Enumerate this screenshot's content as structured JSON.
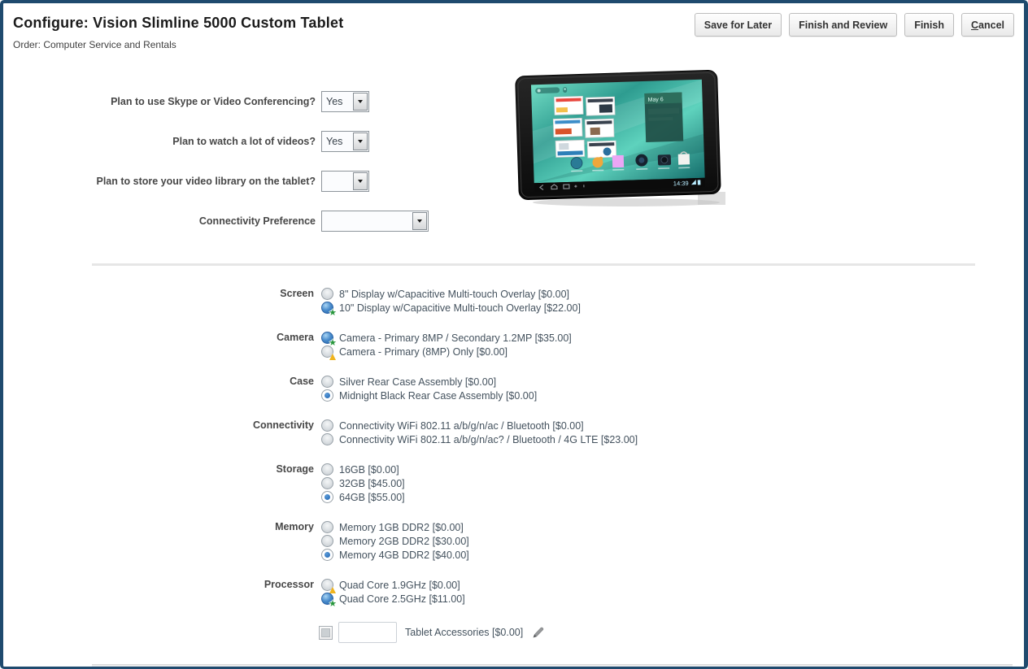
{
  "page": {
    "title": "Configure: Vision Slimline 5000 Custom Tablet",
    "subtitle": "Order: Computer Service and Rentals"
  },
  "toolbar": {
    "buttons": [
      {
        "label": "Save for Later",
        "underline_first_letter": false
      },
      {
        "label": "Finish and Review",
        "underline_first_letter": false
      },
      {
        "label": "Finish",
        "underline_first_letter": false
      },
      {
        "label": "Cancel",
        "underline_first_letter": true
      }
    ]
  },
  "questions": [
    {
      "label": "Plan to use Skype or Video Conferencing?",
      "value": "Yes",
      "size": "small"
    },
    {
      "label": "Plan to watch a lot of videos?",
      "value": "Yes",
      "size": "small"
    },
    {
      "label": "Plan to store your video library on the tablet?",
      "value": "",
      "size": "small"
    },
    {
      "label": "Connectivity Preference",
      "value": "",
      "size": "large"
    }
  ],
  "product_image": {
    "description": "black tablet with teal home screen",
    "time": "14:39",
    "widget_date": "May 6"
  },
  "option_groups": [
    {
      "label": "Screen",
      "options": [
        {
          "text": "8\" Display w/Capacitive Multi-touch Overlay [$0.00]",
          "state": "unselected"
        },
        {
          "text": "10\" Display w/Capacitive Multi-touch Overlay [$22.00]",
          "state": "selected-recommended"
        }
      ]
    },
    {
      "label": "Camera",
      "options": [
        {
          "text": "Camera - Primary 8MP / Secondary 1.2MP [$35.00]",
          "state": "selected-recommended"
        },
        {
          "text": "Camera - Primary (8MP) Only [$0.00]",
          "state": "unselected-warning"
        }
      ]
    },
    {
      "label": "Case",
      "options": [
        {
          "text": "Silver Rear Case Assembly [$0.00]",
          "state": "unselected"
        },
        {
          "text": "Midnight Black Rear Case Assembly [$0.00]",
          "state": "selected"
        }
      ]
    },
    {
      "label": "Connectivity",
      "options": [
        {
          "text": "Connectivity WiFi 802.11 a/b/g/n/ac / Bluetooth [$0.00]",
          "state": "unselected"
        },
        {
          "text": "Connectivity WiFi 802.11 a/b/g/n/ac? / Bluetooth / 4G LTE [$23.00]",
          "state": "unselected"
        }
      ]
    },
    {
      "label": "Storage",
      "options": [
        {
          "text": "16GB [$0.00]",
          "state": "unselected"
        },
        {
          "text": "32GB [$45.00]",
          "state": "unselected"
        },
        {
          "text": "64GB [$55.00]",
          "state": "selected"
        }
      ]
    },
    {
      "label": "Memory",
      "options": [
        {
          "text": "Memory 1GB DDR2 [$0.00]",
          "state": "unselected"
        },
        {
          "text": "Memory 2GB DDR2 [$30.00]",
          "state": "unselected"
        },
        {
          "text": "Memory 4GB DDR2 [$40.00]",
          "state": "selected"
        }
      ]
    },
    {
      "label": "Processor",
      "options": [
        {
          "text": "Quad Core 1.9GHz [$0.00]",
          "state": "unselected-warning"
        },
        {
          "text": "Quad Core 2.5GHz [$11.00]",
          "state": "selected-recommended"
        }
      ]
    }
  ],
  "accessories": {
    "checked": false,
    "quantity_value": "",
    "label": "Tablet Accessories [$0.00]"
  },
  "icons": {
    "recommended_star": "★",
    "warning_triangle": "▲",
    "dropdown_arrow": "▼",
    "edit": "pencil"
  },
  "colors": {
    "frame_navy": "#1f4a6e",
    "recommended_green": "#27963c",
    "warning_amber": "#f0b41e",
    "selected_blue": "#2a6fc0",
    "screen_teal": "#2e9c90",
    "divider_gray": "#e6e6e6"
  }
}
